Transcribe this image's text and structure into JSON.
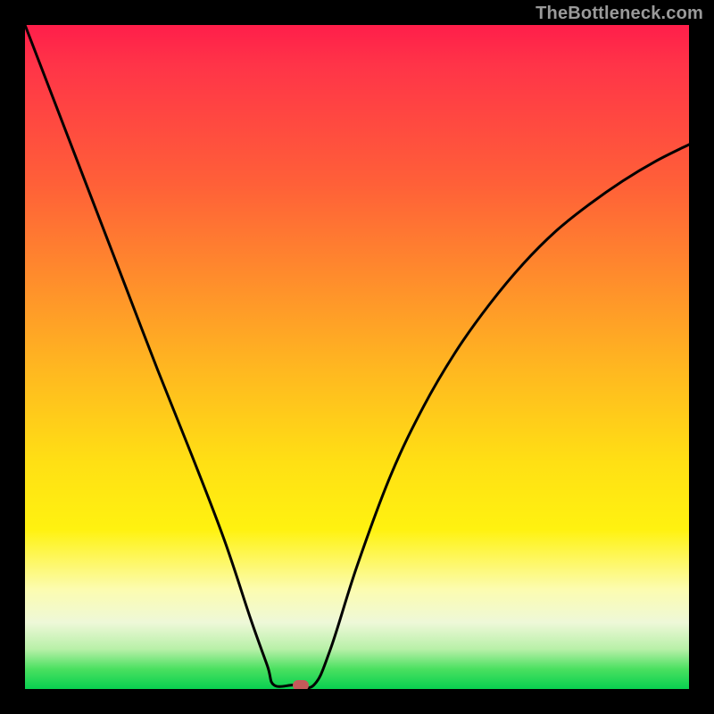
{
  "watermark": "TheBottleneck.com",
  "chart_data": {
    "type": "line",
    "title": "",
    "xlabel": "",
    "ylabel": "",
    "x_range": [
      0,
      1
    ],
    "y_range": [
      0,
      1
    ],
    "min_point_x": 0.405,
    "flat_segment_x": [
      0.375,
      0.435
    ],
    "marker": {
      "x": 0.415,
      "y": 0.006
    },
    "series": [
      {
        "name": "curve",
        "points": [
          {
            "x": 0.0,
            "y": 1.0
          },
          {
            "x": 0.05,
            "y": 0.87
          },
          {
            "x": 0.1,
            "y": 0.74
          },
          {
            "x": 0.15,
            "y": 0.61
          },
          {
            "x": 0.2,
            "y": 0.48
          },
          {
            "x": 0.25,
            "y": 0.355
          },
          {
            "x": 0.3,
            "y": 0.225
          },
          {
            "x": 0.34,
            "y": 0.105
          },
          {
            "x": 0.365,
            "y": 0.035
          },
          {
            "x": 0.375,
            "y": 0.006
          },
          {
            "x": 0.405,
            "y": 0.006
          },
          {
            "x": 0.435,
            "y": 0.006
          },
          {
            "x": 0.46,
            "y": 0.06
          },
          {
            "x": 0.5,
            "y": 0.185
          },
          {
            "x": 0.55,
            "y": 0.32
          },
          {
            "x": 0.6,
            "y": 0.425
          },
          {
            "x": 0.65,
            "y": 0.51
          },
          {
            "x": 0.7,
            "y": 0.58
          },
          {
            "x": 0.75,
            "y": 0.64
          },
          {
            "x": 0.8,
            "y": 0.69
          },
          {
            "x": 0.85,
            "y": 0.73
          },
          {
            "x": 0.9,
            "y": 0.765
          },
          {
            "x": 0.95,
            "y": 0.795
          },
          {
            "x": 1.0,
            "y": 0.82
          }
        ]
      }
    ],
    "background_gradient": {
      "top": "#ff1e4a",
      "mid": "#ffe014",
      "bottom": "#08d050"
    }
  }
}
